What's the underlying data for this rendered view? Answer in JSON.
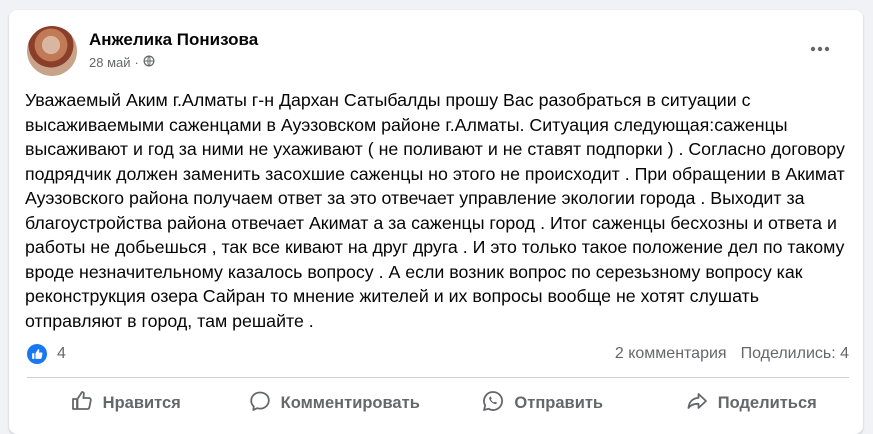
{
  "post": {
    "author": "Анжелика Понизова",
    "date": "28 май",
    "separator": "·",
    "text": "Уважаемый Аким г.Алматы г-н Дархан Сатыбалды  прошу Вас разобраться в ситуации с высаживаемыми саженцами в Ауэзовском районе г.Алматы. Ситуация следующая:саженцы высаживают и год за ними не ухаживают ( не поливают и не ставят подпорки ) . Согласно договору подрядчик должен заменить засохшие саженцы но этого не происходит . При обращении в Акимат Ауэзовского района получаем ответ за это отвечает управление экологии города . Выходит за благоустройства района отвечает Акимат а за саженцы город . Итог саженцы бесхозны и ответа и работы не добьешься , так все кивают на друг друга .  И это только такое положение дел по такому  вроде незначительному  казалось вопросу .  А если возник вопрос по серезьзному вопросу как реконструкция озера Сайран то мнение жителей и их вопросы  вообще не хотят слушать  отправляют в город,  там решайте ."
  },
  "stats": {
    "likes": "4",
    "comments": "2 комментария",
    "shares": "Поделились: 4"
  },
  "actions": {
    "like": "Нравится",
    "comment": "Комментировать",
    "send": "Отправить",
    "share": "Поделиться"
  },
  "icons": {
    "menu": "more-horizontal-icon",
    "audience": "globe-icon",
    "reaction": "like-icon"
  },
  "colors": {
    "accent": "#1877f2",
    "secondary_text": "#65676b"
  }
}
